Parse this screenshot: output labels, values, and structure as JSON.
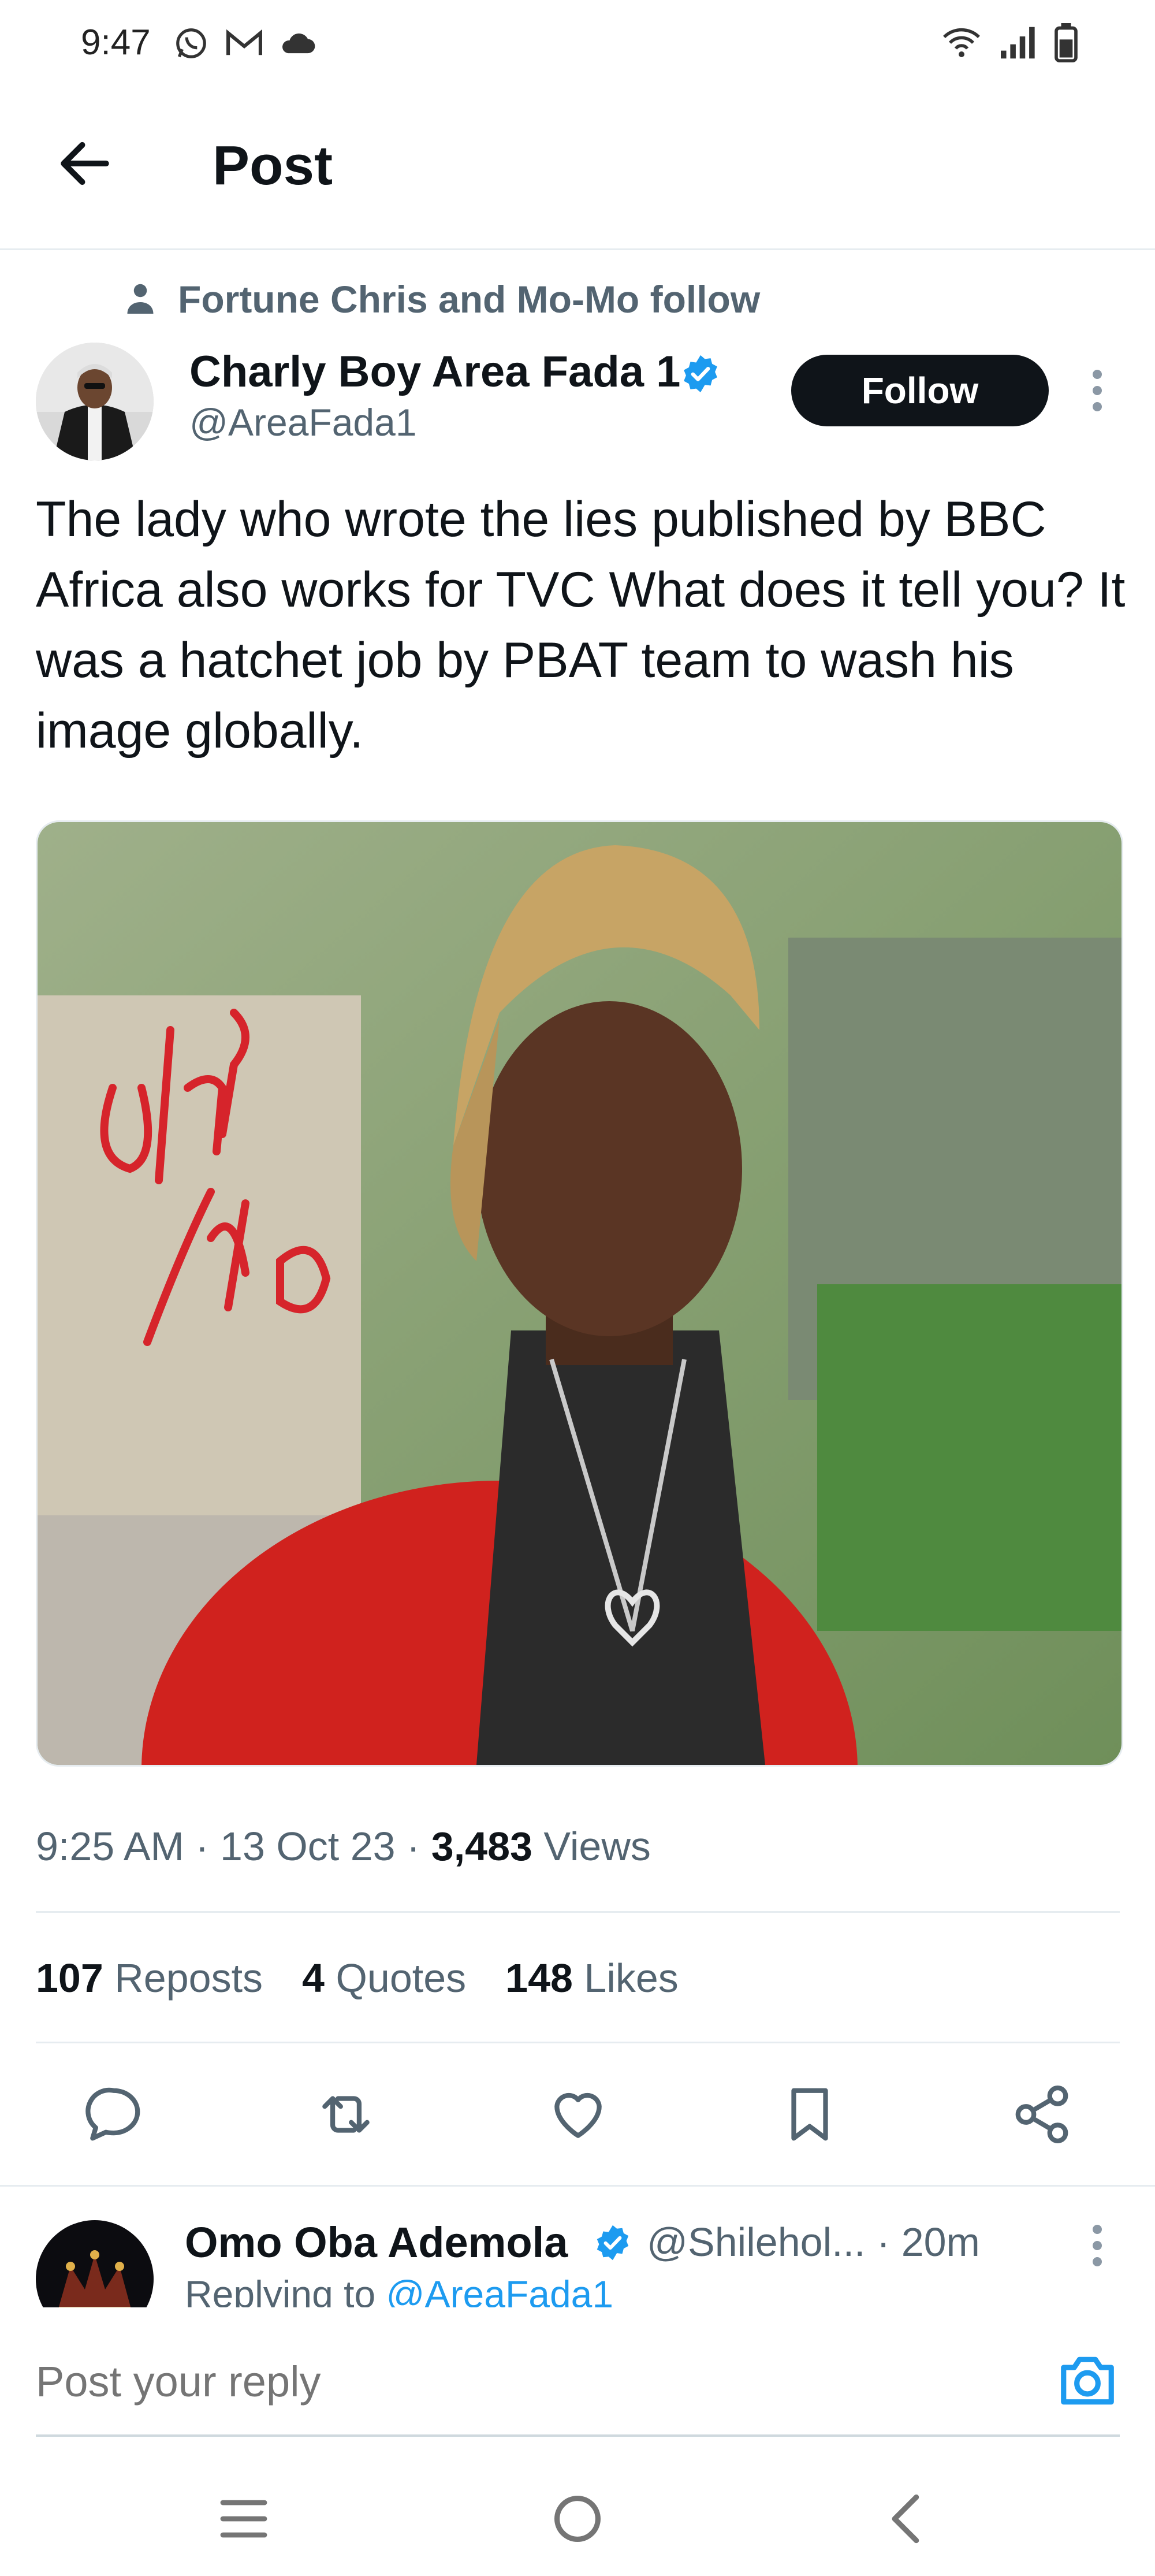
{
  "status_bar": {
    "time": "9:47",
    "left_icons": [
      "whatsapp-icon",
      "gmail-icon",
      "cloud-icon"
    ],
    "right_icons": [
      "wifi-icon",
      "signal-icon",
      "battery-icon"
    ]
  },
  "app_bar": {
    "title": "Post"
  },
  "post": {
    "social_context": "Fortune Chris and Mo-Mo follow",
    "author_name": "Charly Boy Area Fada 1",
    "author_handle": "@AreaFada1",
    "follow_label": "Follow",
    "text": "The lady who wrote the lies published by BBC Africa also works for TVC   What does it tell you?  It was a hatchet job by PBAT team to wash his image globally.",
    "media_watermark": [
      "Olaro",
      "Alo"
    ],
    "time": "9:25 AM",
    "date": "13 Oct 23",
    "views_count": "3,483",
    "views_label": "Views",
    "stats": {
      "reposts_count": "107",
      "reposts_label": "Reposts",
      "quotes_count": "4",
      "quotes_label": "Quotes",
      "likes_count": "148",
      "likes_label": "Likes"
    },
    "actions": [
      "reply-icon",
      "repost-icon",
      "like-icon",
      "bookmark-icon",
      "share-icon"
    ]
  },
  "reply": {
    "author_name": "Omo Oba Ademola",
    "handle": "@Shilehol...",
    "time": "· 20m",
    "replying_to_prefix": "Replying to",
    "replying_to_handle": "@AreaFada1"
  },
  "composer": {
    "placeholder": "Post your reply"
  },
  "colors": {
    "accent": "#1d9bf0",
    "text_primary": "#0f1419",
    "text_secondary": "#536471",
    "divider": "#e6ecf0"
  }
}
